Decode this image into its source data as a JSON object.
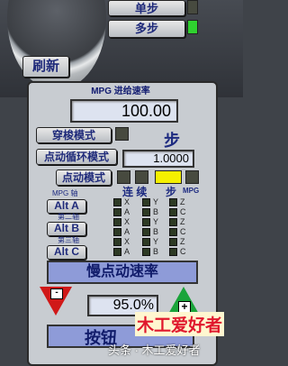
{
  "top": {
    "single_step_label": "单步",
    "multi_step_label": "多步",
    "refresh_label": "刷新"
  },
  "panel": {
    "title": "MPG 进给速率",
    "feed_rate_value": "100.00",
    "traverse_mode_label": "穿梭模式",
    "step_word": "步",
    "step_cycle_label": "点动循环模式",
    "step_value": "1.0000",
    "jog_mode_label": "点动模式",
    "col_continuous": "连 续",
    "col_step": "步",
    "col_mpg": "MPG",
    "mpg_axis_label": "MPG 轴",
    "second_axis_label": "第二轴",
    "third_axis_label": "第三轴",
    "alt_a": "Alt A",
    "alt_b": "Alt B",
    "alt_c": "Alt C",
    "axis_rows": [
      [
        "X",
        "Y",
        "Z"
      ],
      [
        "A",
        "B",
        "C"
      ],
      [
        "X",
        "Y",
        "Z"
      ],
      [
        "A",
        "B",
        "C"
      ],
      [
        "X",
        "Y",
        "Z"
      ],
      [
        "A",
        "B",
        "C"
      ]
    ],
    "slow_jog_label": "慢点动速率",
    "minus_label": "-",
    "plus_label": "+",
    "percent_value": "95.0",
    "percent_unit": "%",
    "bottom_label": "按钮"
  },
  "watermark": {
    "text": "头条 · 木工爱好者",
    "logo": "木工爱好者"
  },
  "colors": {
    "led_green": "#2fd12f",
    "led_yellow": "#f5f000",
    "led_dark": "#474a3f",
    "button_text": "#1f2a7a",
    "minus_red": "#d01818",
    "plus_green": "#1aa43a"
  }
}
